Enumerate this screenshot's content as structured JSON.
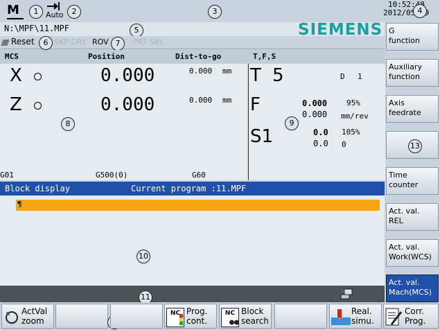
{
  "top": {
    "mode_letter": "M",
    "mode_text": "Auto",
    "time": "10:52:48",
    "date": "2012/05/29",
    "program_path": "N:\\MPF\\11.MPF",
    "brand": "SIEMENS",
    "reset": "Reset",
    "rov": "ROV",
    "status_flags_dim": "SKP DRY",
    "status_flags_dim2": "PRT SBL",
    "colors": {
      "brand": "#1aa0a0",
      "accent": "#2150a8",
      "highlight": "#f4a40c"
    }
  },
  "callouts": {
    "c1": "1",
    "c2": "2",
    "c3": "3",
    "c4": "4",
    "c5": "5",
    "c6": "6",
    "c7": "7",
    "c8": "8",
    "c9": "9",
    "c10": "10",
    "c11": "11",
    "c12": "12",
    "c13": "13"
  },
  "header": {
    "mcs": "MCS",
    "position": "Position",
    "dist": "Dist-to-go",
    "tfs": "T,F,S"
  },
  "axes": [
    {
      "name": "X",
      "position": "0.000",
      "dist": "0.000",
      "unit": "mm"
    },
    {
      "name": "Z",
      "position": "0.000",
      "dist": "0.000",
      "unit": "mm"
    }
  ],
  "tfs": {
    "t_label": "T",
    "t_value": "5",
    "d_label": "D",
    "d_value": "1",
    "f_label": "F",
    "f_act": "0.000",
    "f_set": "0.000",
    "f_pct": "95%",
    "f_unit": "mm/rev",
    "s_label": "S1",
    "s_act": "0.0",
    "s_set": "0.0",
    "s_pct": "105%",
    "s_unit": "0"
  },
  "gcodes": {
    "g1": "G01",
    "g2": "G500(0)",
    "g3": "G60"
  },
  "block": {
    "title": "Block display",
    "program": "Current program :11.MPF",
    "line": "¶"
  },
  "vsoftkeys": [
    {
      "line1": "G",
      "line2": "function"
    },
    {
      "line1": "Auxiliary",
      "line2": "function"
    },
    {
      "line1": "Axis",
      "line2": "feedrate"
    },
    {
      "line1": "",
      "line2": ""
    },
    {
      "line1": "Time",
      "line2": "counter"
    },
    {
      "line1": "Act. val.",
      "line2": "REL"
    },
    {
      "line1": "Act. val.",
      "line2": "Work(WCS)"
    },
    {
      "line1": "Act. val.",
      "line2": "Mach(MCS)"
    }
  ],
  "hsoftkeys": {
    "actval_1": "ActVal",
    "actval_2": "zoom",
    "prog_1": "Prog.",
    "prog_2": "cont.",
    "block_1": "Block",
    "block_2": "search",
    "real_1": "Real.",
    "real_2": "simu.",
    "corr_1": "Corr.",
    "corr_2": "Prog.",
    "nc": "NC"
  }
}
